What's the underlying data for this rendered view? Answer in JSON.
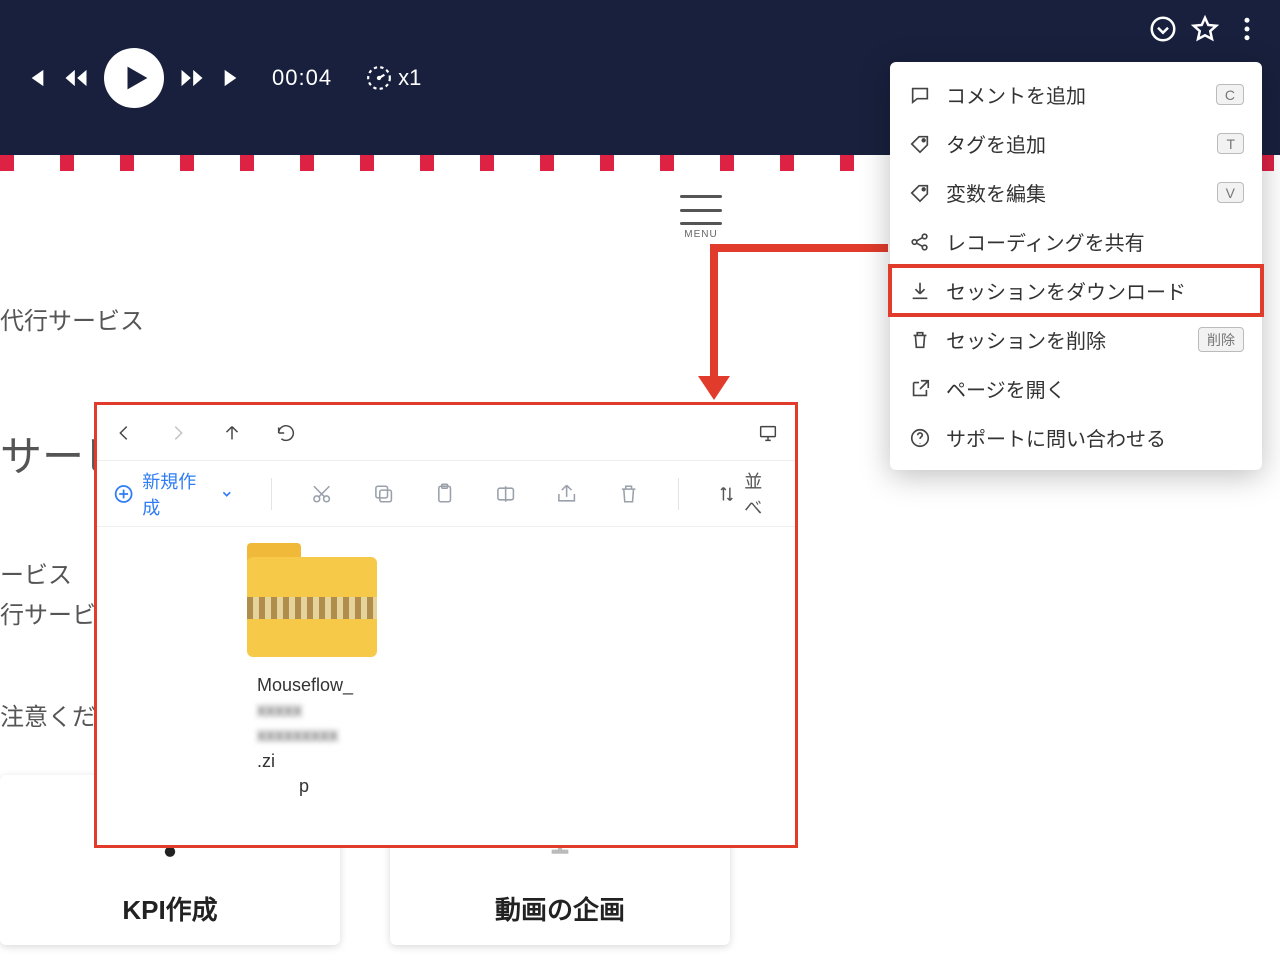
{
  "player": {
    "time": "00:04",
    "speed": "x1"
  },
  "dropdown": {
    "items": [
      {
        "icon": "comment-icon",
        "label": "コメントを追加",
        "key": "C"
      },
      {
        "icon": "tag-icon",
        "label": "タグを追加",
        "key": "T"
      },
      {
        "icon": "tag-icon",
        "label": "変数を編集",
        "key": "V"
      },
      {
        "icon": "share-icon",
        "label": "レコーディングを共有"
      },
      {
        "icon": "download-icon",
        "label": "セッションをダウンロード",
        "highlight": true
      },
      {
        "icon": "trash-icon",
        "label": "セッションを削除",
        "key": "削除"
      },
      {
        "icon": "open-icon",
        "label": "ページを開く"
      },
      {
        "icon": "help-icon",
        "label": "サポートに問い合わせる"
      }
    ]
  },
  "page": {
    "menu_label": "MENU",
    "line1": "代行サービス",
    "heading": "サービ",
    "line2": "ービス",
    "line3": "行サービ",
    "line4": "注意くだ",
    "cards": [
      {
        "title": "KPI作成"
      },
      {
        "title": "動画の企画"
      }
    ]
  },
  "file_window": {
    "new_label": "新規作成",
    "sort_label": "並べ",
    "files": [
      {
        "name_prefix": "Mouseflow_",
        "ext": ".zip"
      }
    ]
  }
}
